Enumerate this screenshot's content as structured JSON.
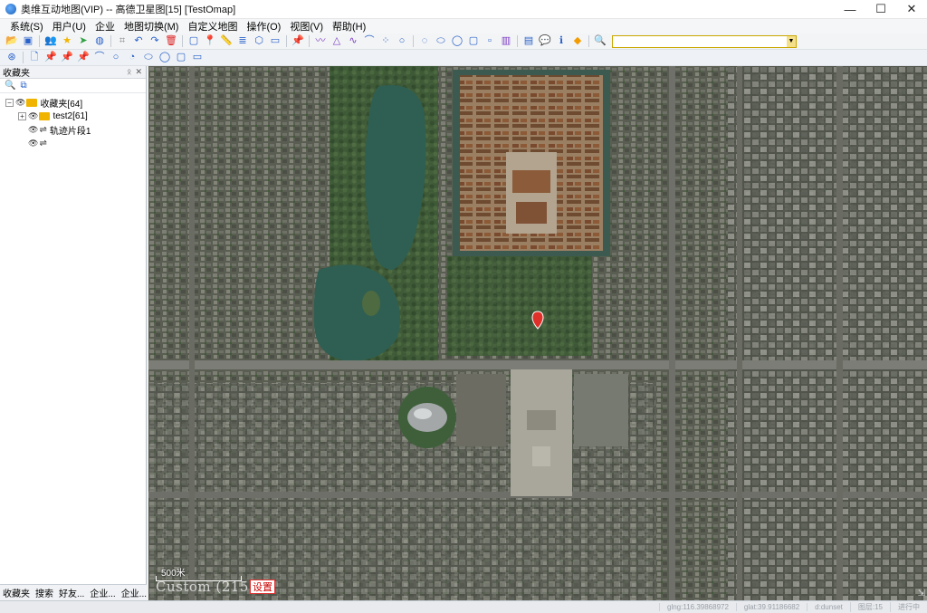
{
  "window": {
    "title": "奥维互动地图(VIP) -- 高德卫星图[15] [TestOmap]",
    "minimize": "—",
    "maximize": "☐",
    "close": "✕"
  },
  "menu": [
    "系统(S)",
    "用户(U)",
    "企业",
    "地图切换(M)",
    "自定义地图",
    "操作(O)",
    "视图(V)",
    "帮助(H)"
  ],
  "toolbar1": {
    "icons": [
      {
        "name": "open-folder-icon",
        "glyph": "📂",
        "color": "#e8a100"
      },
      {
        "name": "save-icon",
        "glyph": "▣",
        "color": "#2a62c9"
      },
      {
        "name": "users-icon",
        "glyph": "👥",
        "color": "#3a70c7"
      },
      {
        "name": "favorite-star-icon",
        "glyph": "★",
        "color": "#f2b600"
      },
      {
        "name": "pin-green-icon",
        "glyph": "➤",
        "color": "#2ea043"
      },
      {
        "name": "globe-icon",
        "glyph": "◍",
        "color": "#2a62c9"
      },
      {
        "name": "crop-icon",
        "glyph": "⌗",
        "color": "#888"
      },
      {
        "name": "undo-icon",
        "glyph": "↶",
        "color": "#2a62c9"
      },
      {
        "name": "redo-icon",
        "glyph": "↷",
        "color": "#2a62c9"
      },
      {
        "name": "delete-icon",
        "glyph": "🗑",
        "color": "#d22"
      },
      {
        "name": "select-rect-icon",
        "glyph": "▢",
        "color": "#2a62c9"
      },
      {
        "name": "marker-icon",
        "glyph": "📍",
        "color": "#7b3fc4"
      },
      {
        "name": "ruler-icon",
        "glyph": "📏",
        "color": "#2a62c9"
      },
      {
        "name": "layers-icon",
        "glyph": "≣",
        "color": "#2a62c9"
      },
      {
        "name": "hexagon-icon",
        "glyph": "⬡",
        "color": "#2a62c9"
      },
      {
        "name": "video-icon",
        "glyph": "▭",
        "color": "#2a62c9"
      },
      {
        "name": "pushpin-icon",
        "glyph": "📌",
        "color": "#2a62c9"
      },
      {
        "name": "polyline-icon",
        "glyph": "〰",
        "color": "#7b3fc4"
      },
      {
        "name": "triangle-icon",
        "glyph": "△",
        "color": "#7b3fc4"
      },
      {
        "name": "curve-icon",
        "glyph": "∿",
        "color": "#7b3fc4"
      },
      {
        "name": "arc-icon",
        "glyph": "⌒",
        "color": "#2a62c9"
      },
      {
        "name": "point-group-icon",
        "glyph": "⁘",
        "color": "#2a62c9"
      },
      {
        "name": "circle-icon",
        "glyph": "○",
        "color": "#2a62c9"
      },
      {
        "name": "arc-circle-icon",
        "glyph": "◌",
        "color": "#2a62c9"
      },
      {
        "name": "ellipse-icon",
        "glyph": "⬭",
        "color": "#2a62c9"
      },
      {
        "name": "circle-fill-icon",
        "glyph": "◯",
        "color": "#2a62c9"
      },
      {
        "name": "square-icon",
        "glyph": "▢",
        "color": "#2a62c9"
      },
      {
        "name": "rect-small-icon",
        "glyph": "▫",
        "color": "#2a62c9"
      },
      {
        "name": "barcode-icon",
        "glyph": "▥",
        "color": "#7b3fc4"
      },
      {
        "name": "chart-icon",
        "glyph": "▤",
        "color": "#2a62c9"
      },
      {
        "name": "chat-icon",
        "glyph": "💬",
        "color": "#2ea043"
      },
      {
        "name": "info-icon",
        "glyph": "ℹ",
        "color": "#2a62c9"
      },
      {
        "name": "diamond-icon",
        "glyph": "◆",
        "color": "#f29c00"
      },
      {
        "name": "search-icon",
        "glyph": "🔍",
        "color": "#2a62c9"
      }
    ]
  },
  "search": {
    "value": "",
    "placeholder": ""
  },
  "toolbar2": {
    "icons": [
      {
        "name": "compass-icon",
        "glyph": "⊛",
        "color": "#2a62c9"
      },
      {
        "name": "document-icon",
        "glyph": "🗋",
        "color": "#2a62c9"
      },
      {
        "name": "pin-yellow-icon",
        "glyph": "📌",
        "color": "#e0b000"
      },
      {
        "name": "pin-blue-icon",
        "glyph": "📌",
        "color": "#2a62c9"
      },
      {
        "name": "pin-green2-icon",
        "glyph": "📌",
        "color": "#2ea043"
      },
      {
        "name": "arc-line-icon",
        "glyph": "⌒",
        "color": "#2a62c9"
      },
      {
        "name": "circle-outline-icon",
        "glyph": "○",
        "color": "#2a62c9"
      },
      {
        "name": "partial-circle-icon",
        "glyph": "◔",
        "color": "#2a62c9"
      },
      {
        "name": "ellipse-outline-icon",
        "glyph": "⬭",
        "color": "#2a62c9"
      },
      {
        "name": "circle-blue-icon",
        "glyph": "◯",
        "color": "#2a62c9"
      },
      {
        "name": "square-blue-icon",
        "glyph": "▢",
        "color": "#2a62c9"
      },
      {
        "name": "rect-blue-icon",
        "glyph": "▭",
        "color": "#2a62c9"
      }
    ]
  },
  "panel": {
    "title": "收藏夹",
    "pin": "ᛟ",
    "close": "✕",
    "tools": [
      {
        "name": "search-icon",
        "glyph": "🔍",
        "color": "#2a62c9"
      },
      {
        "name": "copy-icon",
        "glyph": "⧉",
        "color": "#2a62c9"
      }
    ],
    "tree": [
      {
        "label": "收藏夹[64]",
        "level": 0,
        "expander": "⊟",
        "type": "folder"
      },
      {
        "label": "test2[61]",
        "level": 1,
        "expander": "⊞",
        "type": "folder"
      },
      {
        "label": "轨迹片段1",
        "level": 1,
        "expander": "",
        "type": "track"
      },
      {
        "label": "",
        "level": 1,
        "expander": "",
        "type": "track"
      }
    ],
    "tabs": [
      "收藏夹",
      "搜索",
      "好友...",
      "企业...",
      "企业..."
    ]
  },
  "map": {
    "scale_label": "500米",
    "custom_label": "Custom (215)",
    "settings_button": "设置"
  },
  "statusbar": {
    "cells": [
      "glng:116.39868972",
      "glat:39.91186682",
      "d:dunset",
      "图层:15",
      "进行中"
    ]
  }
}
